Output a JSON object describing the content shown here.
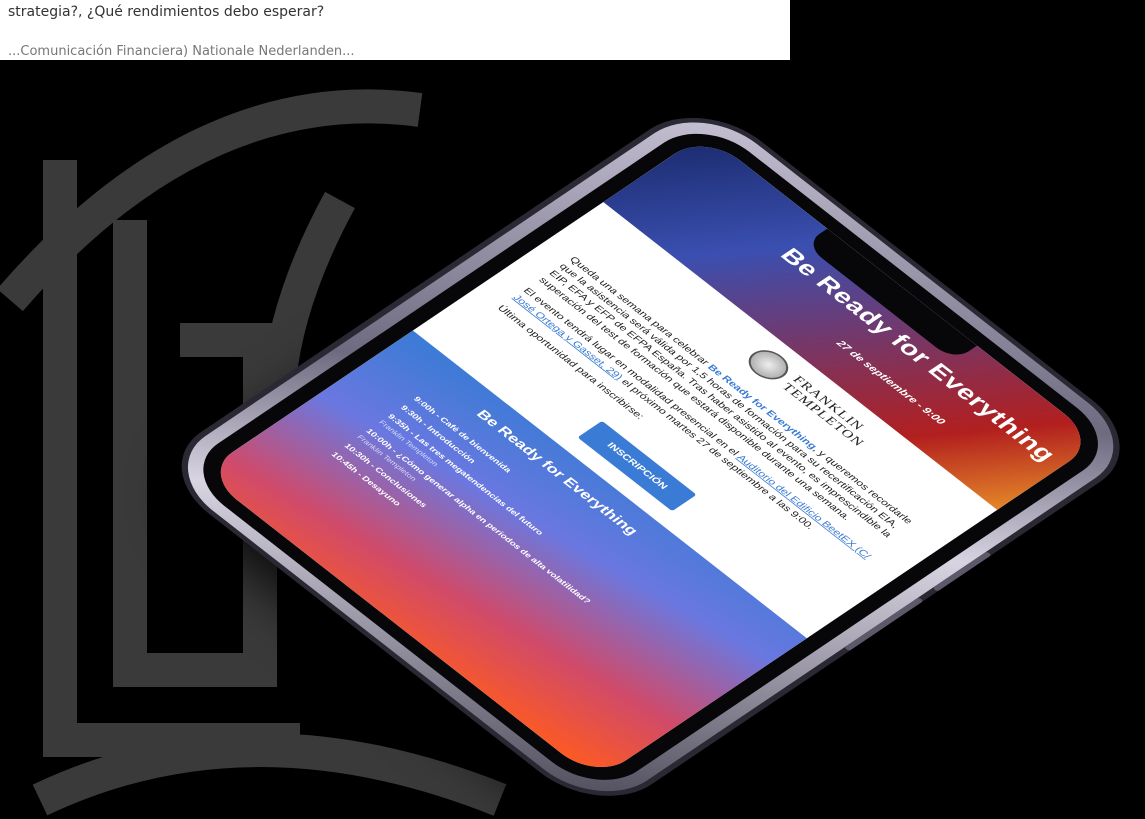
{
  "document": {
    "line1": "strategia?, ¿Qué rendimientos debo esperar?",
    "line2": "...Comunicación Financiera) Nationale Nederlanden..."
  },
  "email": {
    "hero_title": "Be Ready for Everything",
    "hero_subtitle": "27 de septiembre - 9:00",
    "logo_line1": "FRANKLIN",
    "logo_line2": "TEMPLETON",
    "para1_a": "Queda una semana para celebrar ",
    "para1_link": "Be Ready for Everything",
    "para1_b": ", y queremos recordarle que la asistencia será válida por 1,5 horas de formación para su recertificación EIA, EIP, EFA y EFP de EFPA España. Tras haber asistido al evento, es imprescindible la superación del test de formación que estará disponible durante una semana.",
    "para2_a": "El evento tendrá lugar en modalidad presencial en el ",
    "para2_link1": "Auditorio del Edificio BeetEX (C/ José Ortega y Gasset, 29)",
    "para2_b": " el próximo martes 27 de septiembre a las 9:00.",
    "para3": "Última oportunidad para inscribirse:",
    "cta_label": "INSCRIPCIÓN",
    "agenda_title": "Be Ready for Everything",
    "agenda": [
      {
        "time": "9:00h - Café de bienvenida",
        "desc": ""
      },
      {
        "time": "9:30h - Introducción",
        "desc": ""
      },
      {
        "time": "9:35h - Las tres megatendencias del futuro",
        "desc": "Franklin Templeton"
      },
      {
        "time": "10:00h - ¿Cómo generar alpha en periodos de alta volatilidad?",
        "desc": "Franklin Templeton"
      },
      {
        "time": "10:30h - Conclusiones",
        "desc": ""
      },
      {
        "time": "10:45h - Desayuno",
        "desc": ""
      }
    ]
  },
  "colors": {
    "accent": "#3a7bd5",
    "gradient_end": "#ff5a1f"
  }
}
